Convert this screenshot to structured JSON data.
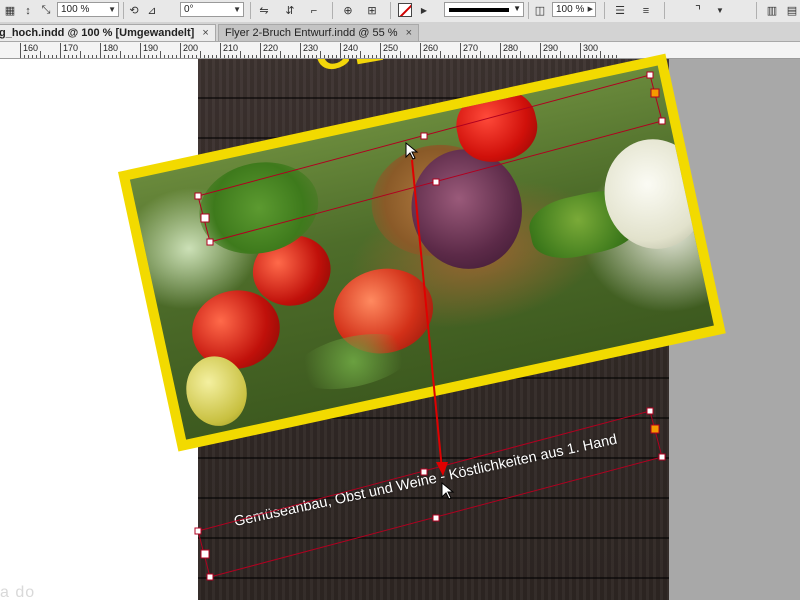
{
  "control_bar": {
    "scale_x": "100 %",
    "rotation": "0°",
    "stroke_color": "#d00000",
    "zoom_field": "100 %",
    "icons": [
      "reference-point-icon",
      "rotate-icon",
      "shear-icon",
      "flip-icon",
      "select-container-icon",
      "align-icon",
      "fill-stroke-icon",
      "stroke-style-icon",
      "opacity-icon",
      "text-wrap-icon",
      "corner-icon",
      "columns-icon"
    ]
  },
  "tabs": [
    {
      "label": "g_hoch.indd @ 100 % [Umgewandelt]",
      "close": "×",
      "active": true
    },
    {
      "label": "Flyer 2-Bruch Entwurf.indd @ 55 %",
      "close": "×",
      "active": false
    }
  ],
  "ruler": {
    "labels": [
      "160",
      "170",
      "180",
      "190",
      "200",
      "210",
      "220",
      "230",
      "240",
      "250",
      "260",
      "270",
      "280",
      "290",
      "300"
    ]
  },
  "document": {
    "headline": "GESU",
    "banner_text_top": "Gemüseanbau, Obst und Weine - Köstlichkeiten aus 1. Hand",
    "banner_text_bottom": "Gemüseanbau, Obst und Weine - Köstlichkeiten aus 1. Hand",
    "frame_color": "#f2da00",
    "selection_color": "#b00020",
    "guide_color": "#e00000"
  },
  "watermark": "a do"
}
